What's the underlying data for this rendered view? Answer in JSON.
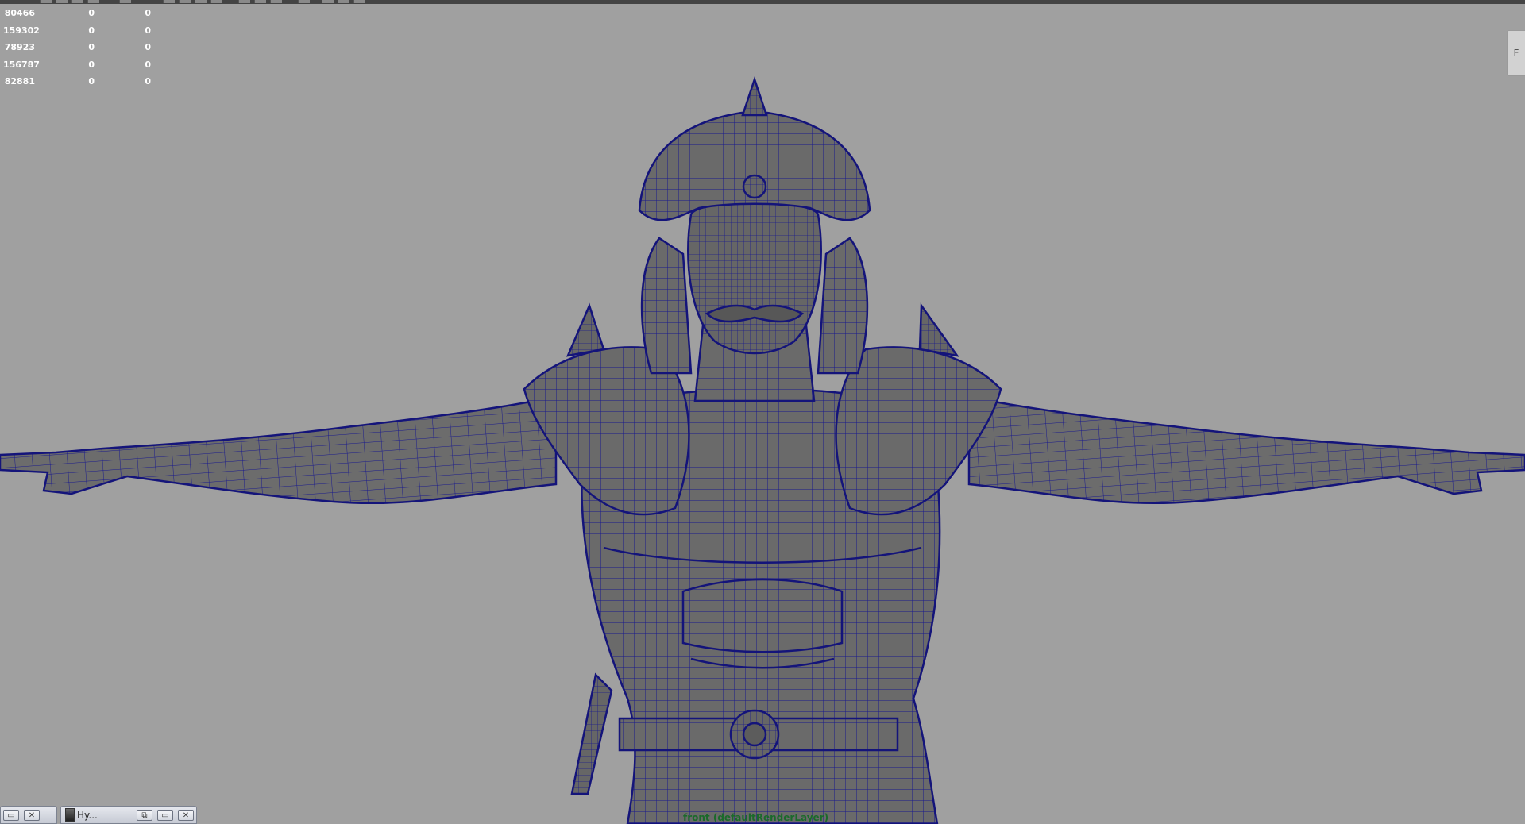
{
  "hud": {
    "rows": [
      [
        "80466",
        "0",
        "0"
      ],
      [
        "159302",
        "0",
        "0"
      ],
      [
        "78923",
        "0",
        "0"
      ],
      [
        "156787",
        "0",
        "0"
      ],
      [
        "82881",
        "0",
        "0"
      ]
    ]
  },
  "viewcube": {
    "label": "F"
  },
  "viewport": {
    "label": "front (defaultRenderLayer)"
  },
  "taskbar": {
    "window2_title": "Hy...",
    "minimize_glyph": "▭",
    "restore_glyph": "⧉",
    "close_glyph": "✕"
  },
  "colors": {
    "background": "#a0a0a0",
    "mesh_fill": "#6a6a6a",
    "wireframe": "#1a1a8c",
    "hud_text": "#ffffff",
    "view_label": "#1a6a2a"
  }
}
